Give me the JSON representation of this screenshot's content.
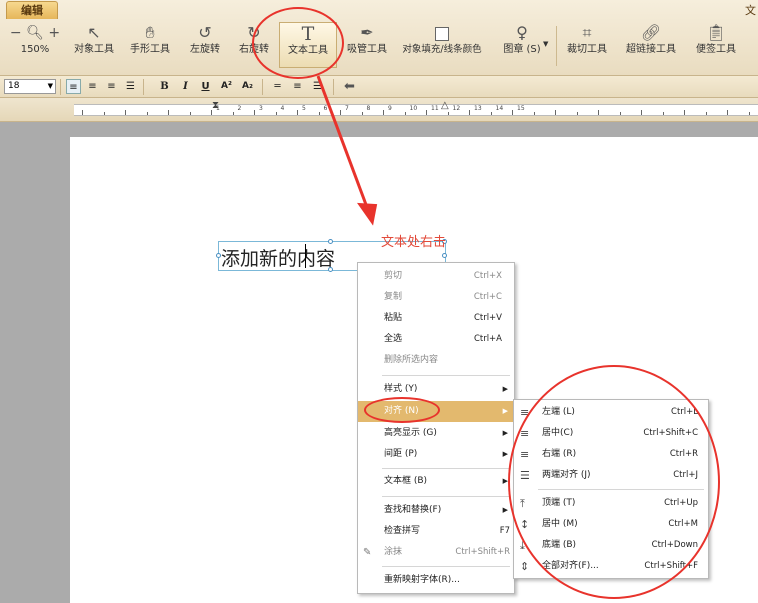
{
  "ribbon": {
    "tab_edit": "编辑",
    "tab_right": "文",
    "zoom_minus": "−",
    "zoom_plus": "+",
    "zoom_level": "150%",
    "tools": [
      {
        "label": "对象工具",
        "icon": "pointer-icon"
      },
      {
        "label": "手形工具",
        "icon": "hand-icon"
      },
      {
        "label": "左旋转",
        "icon": "rotate-left-icon"
      },
      {
        "label": "右旋转",
        "icon": "rotate-right-icon"
      },
      {
        "label": "文本工具",
        "icon": "text-icon"
      },
      {
        "label": "吸管工具",
        "icon": "eyedropper-icon"
      },
      {
        "label": "对象填充/线条颜色",
        "icon": "fill-square-icon"
      },
      {
        "label": "图章 (S)",
        "icon": "stamp-icon"
      },
      {
        "label": "裁切工具",
        "icon": "crop-icon"
      },
      {
        "label": "超链接工具",
        "icon": "link-icon"
      },
      {
        "label": "便签工具",
        "icon": "note-icon"
      }
    ]
  },
  "format": {
    "font_size": "18",
    "bold": "B",
    "italic": "I",
    "underline": "U",
    "superscript": "A²",
    "subscript": "A₂"
  },
  "ruler": {
    "numbers": [
      "1",
      "2",
      "3",
      "4",
      "5",
      "6",
      "7",
      "8",
      "9",
      "10",
      "11",
      "12",
      "13",
      "14",
      "15"
    ]
  },
  "document": {
    "text_before_caret": "添加新的",
    "text_after_caret": "内容",
    "annotation": "文本处右击"
  },
  "context_menu": {
    "items": [
      {
        "label": "剪切",
        "shortcut": "Ctrl+X",
        "disabled": true
      },
      {
        "label": "复制",
        "shortcut": "Ctrl+C",
        "disabled": true
      },
      {
        "label": "粘贴",
        "shortcut": "Ctrl+V"
      },
      {
        "label": "全选",
        "shortcut": "Ctrl+A"
      },
      {
        "label": "删除所选内容",
        "shortcut": "",
        "disabled": true
      },
      {
        "label": "样式 (Y)",
        "submenu": true
      },
      {
        "label": "对齐 (N)",
        "submenu": true,
        "highlighted": true
      },
      {
        "label": "高亮显示 (G)",
        "submenu": true
      },
      {
        "label": "间距 (P)",
        "submenu": true
      },
      {
        "label": "文本框 (B)",
        "submenu": true
      },
      {
        "label": "查找和替换(F)",
        "submenu": true
      },
      {
        "label": "检查拼写",
        "shortcut": "F7"
      },
      {
        "label": "涂抹",
        "shortcut": "Ctrl+Shift+R",
        "disabled": true
      },
      {
        "label": "重新映射字体(R)..."
      }
    ]
  },
  "align_submenu": {
    "items": [
      {
        "label": "左端 (L)",
        "shortcut": "Ctrl+L"
      },
      {
        "label": "居中(C)",
        "shortcut": "Ctrl+Shift+C"
      },
      {
        "label": "右端 (R)",
        "shortcut": "Ctrl+R"
      },
      {
        "label": "两端对齐 (J)",
        "shortcut": "Ctrl+J"
      },
      {
        "label": "顶端 (T)",
        "shortcut": "Ctrl+Up"
      },
      {
        "label": "居中 (M)",
        "shortcut": "Ctrl+M"
      },
      {
        "label": "底端 (B)",
        "shortcut": "Ctrl+Down"
      },
      {
        "label": "全部对齐(F)...",
        "shortcut": "Ctrl+Shift+F"
      }
    ]
  },
  "colors": {
    "annotation_red": "#e8332c",
    "menu_highlight": "#e3b96e",
    "ribbon_bg": "#efe4cb"
  }
}
